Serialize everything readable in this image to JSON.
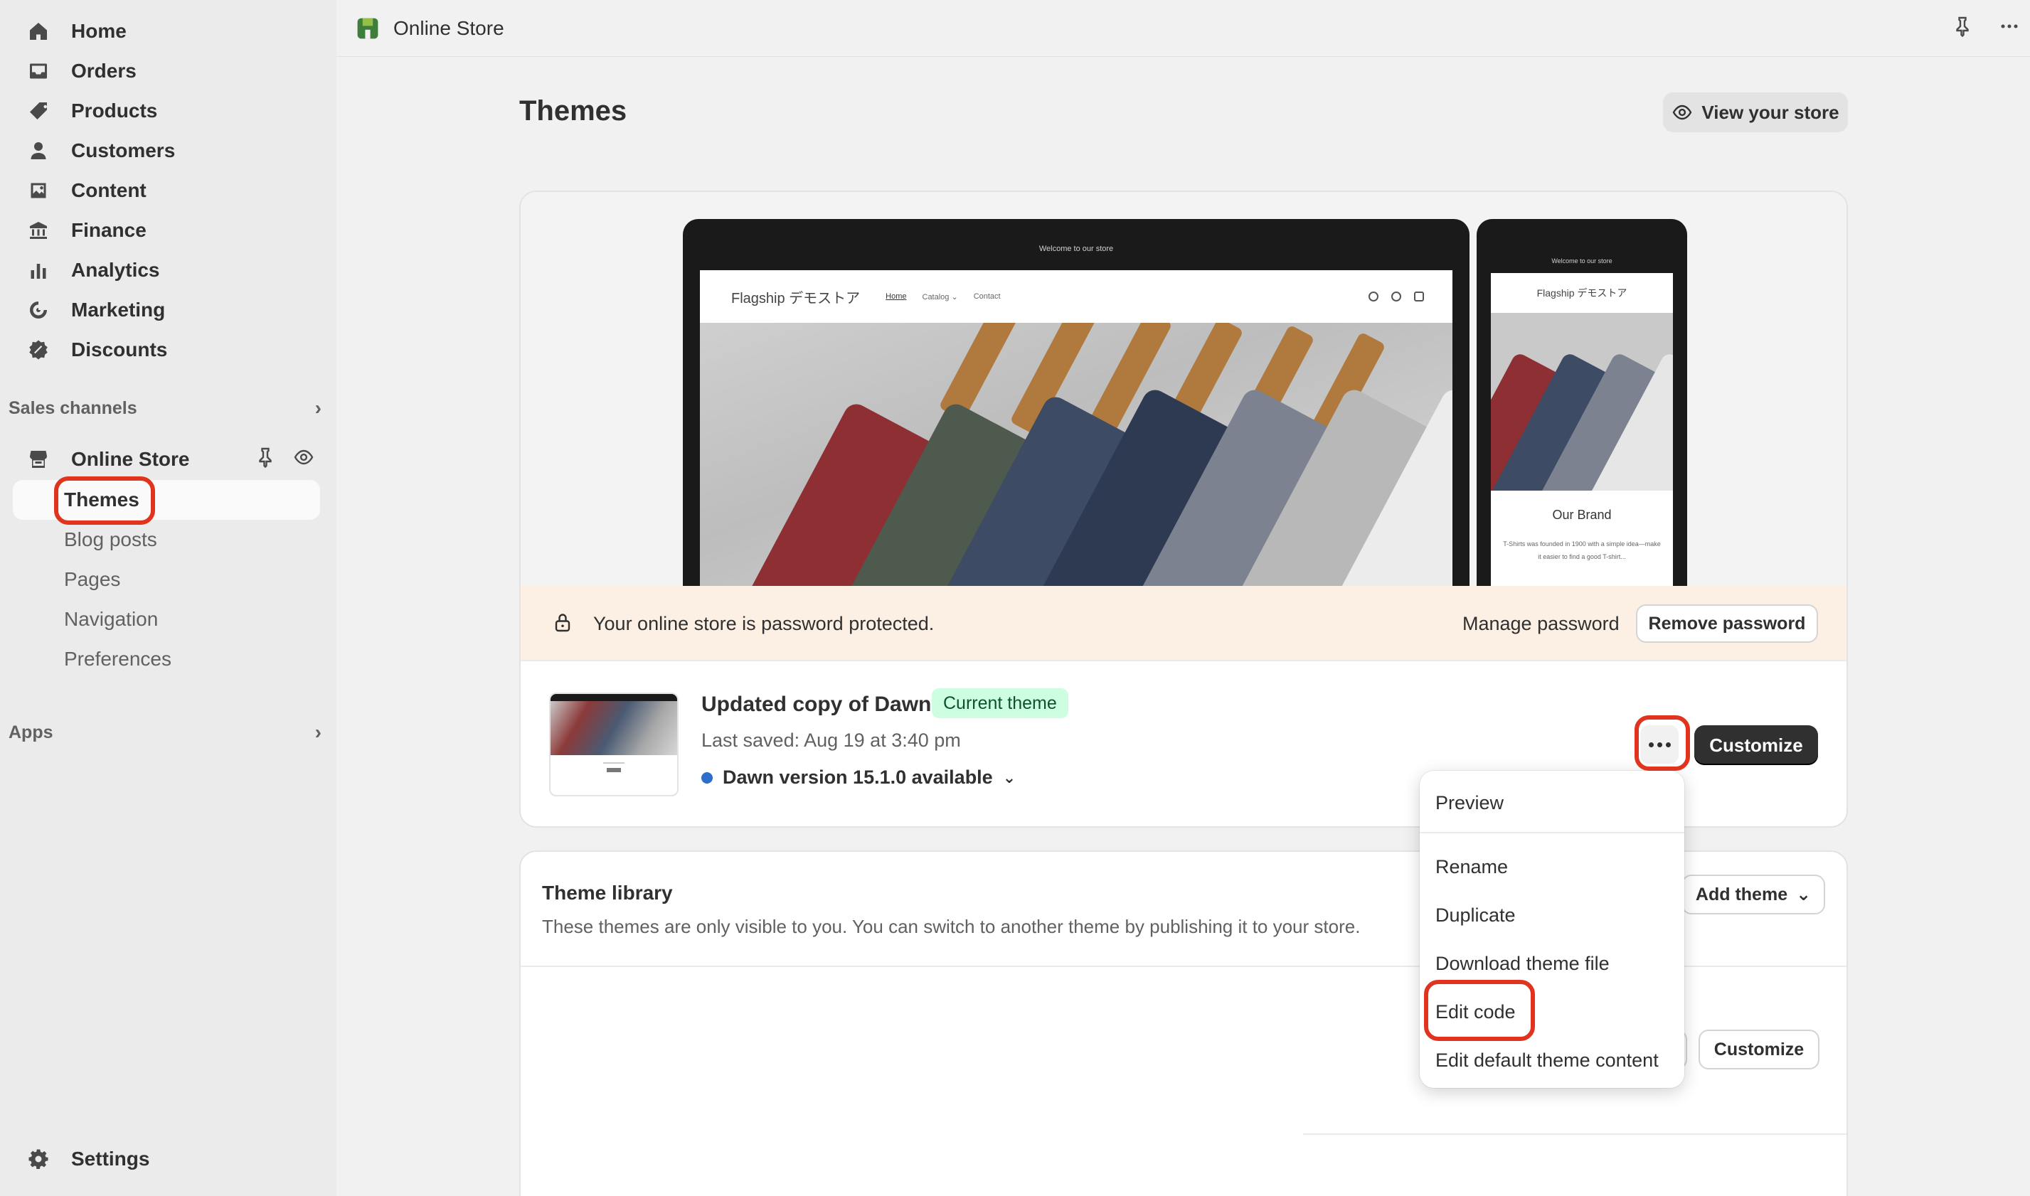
{
  "sidebar": {
    "main_nav": [
      {
        "label": "Home",
        "icon": "home-icon"
      },
      {
        "label": "Orders",
        "icon": "inbox-icon"
      },
      {
        "label": "Products",
        "icon": "tag-icon"
      },
      {
        "label": "Customers",
        "icon": "person-icon"
      },
      {
        "label": "Content",
        "icon": "image-icon"
      },
      {
        "label": "Finance",
        "icon": "bank-icon"
      },
      {
        "label": "Analytics",
        "icon": "bar-chart-icon"
      },
      {
        "label": "Marketing",
        "icon": "target-icon"
      },
      {
        "label": "Discounts",
        "icon": "discount-icon"
      }
    ],
    "sales_channels_label": "Sales channels",
    "online_store_label": "Online Store",
    "sub_items": [
      "Themes",
      "Blog posts",
      "Pages",
      "Navigation",
      "Preferences"
    ],
    "apps_label": "Apps",
    "settings_label": "Settings"
  },
  "topbar": {
    "title": "Online Store"
  },
  "main": {
    "page_title": "Themes",
    "view_store_label": "View your store",
    "preview": {
      "announcement": "Welcome to our store",
      "store_name": "Flagship デモストア",
      "nav": [
        "Home",
        "Catalog ⌄",
        "Contact"
      ],
      "mobile_store_name": "Flagship デモストア",
      "mobile_brand": "Our Brand",
      "mobile_text": "T-Shirts was founded in 1900 with a simple idea—make it easier to find a good T-shirt..."
    },
    "password_banner": {
      "text": "Your online store is password protected.",
      "manage_label": "Manage password",
      "remove_label": "Remove password"
    },
    "current_theme": {
      "name": "Updated copy of Dawn",
      "badge": "Current theme",
      "last_saved": "Last saved: Aug 19 at 3:40 pm",
      "version": "Dawn version 15.1.0 available",
      "customize_label": "Customize"
    },
    "library": {
      "title": "Theme library",
      "description": "These themes are only visible to you. You can switch to another theme by publishing it to your store.",
      "add_theme_label": "Add theme",
      "customize_label": "Customize"
    },
    "actions_menu": {
      "items": [
        "Preview",
        "Rename",
        "Duplicate",
        "Download theme file",
        "Edit code",
        "Edit default theme content"
      ]
    }
  },
  "colors": {
    "accent_dark": "#303030",
    "badge_bg": "#cdfee1",
    "banner_bg": "#fcefe3",
    "annotation_red": "#e0341e"
  }
}
